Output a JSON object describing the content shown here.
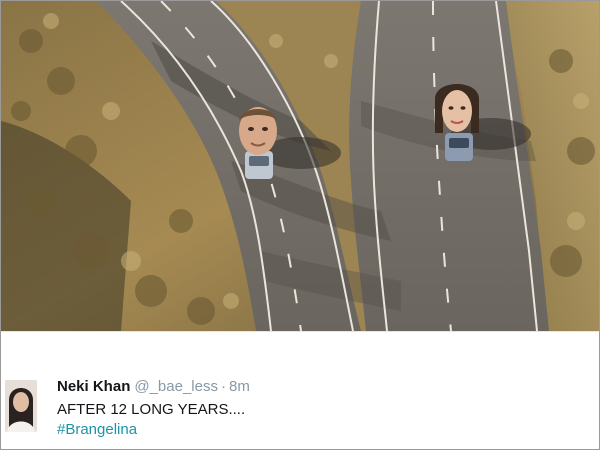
{
  "photo": {
    "description_icon": "aerial-road-photo",
    "colors": {
      "road": "#75706a",
      "hill_left": "#a68a52",
      "hill_right": "#b39a62",
      "lane_line": "#ebe6dc"
    }
  },
  "tweet": {
    "author_name": "Neki Khan",
    "handle": "@_bae_less",
    "separator": "·",
    "time": "8m",
    "text": "AFTER 12 LONG YEARS....",
    "hashtag": "#Brangelina",
    "hashtag_color": "#1b95a6",
    "avatar_icon": "user-avatar"
  }
}
